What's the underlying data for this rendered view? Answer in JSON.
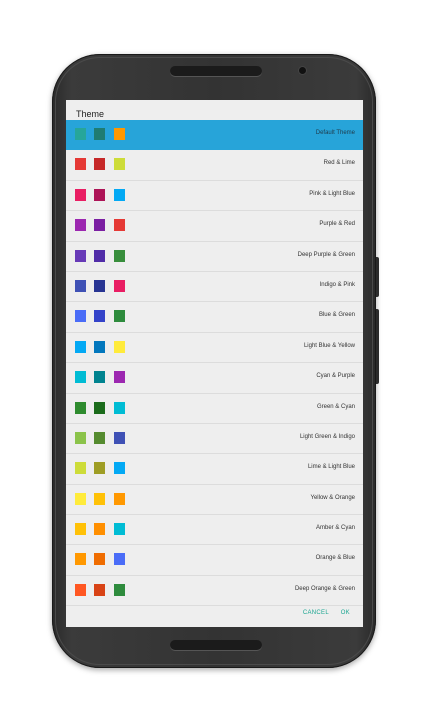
{
  "dialog": {
    "title": "Theme",
    "cancel_label": "CANCEL",
    "ok_label": "OK",
    "selected_color": "#27a4d9"
  },
  "themes": [
    {
      "label": "Default Theme",
      "selected": true,
      "swatches": [
        "#26a69a",
        "#1f7c72",
        "#ff9800"
      ]
    },
    {
      "label": "Red & Lime",
      "swatches": [
        "#e53935",
        "#c62828",
        "#cddc39"
      ]
    },
    {
      "label": "Pink & Light Blue",
      "swatches": [
        "#e91e63",
        "#ad1457",
        "#03a9f4"
      ]
    },
    {
      "label": "Purple & Red",
      "swatches": [
        "#9c27b0",
        "#7b1fa2",
        "#e53935"
      ]
    },
    {
      "label": "Deep Purple & Green",
      "swatches": [
        "#673ab7",
        "#512da8",
        "#388e3c"
      ]
    },
    {
      "label": "Indigo & Pink",
      "swatches": [
        "#3f51b5",
        "#283593",
        "#e91e63"
      ]
    },
    {
      "label": "Blue & Green",
      "swatches": [
        "#4a6cf7",
        "#3443c9",
        "#2e8b3d"
      ]
    },
    {
      "label": "Light Blue & Yellow",
      "swatches": [
        "#03a9f4",
        "#0277bd",
        "#ffeb3b"
      ]
    },
    {
      "label": "Cyan & Purple",
      "swatches": [
        "#00bcd4",
        "#00838f",
        "#9c27b0"
      ]
    },
    {
      "label": "Green & Cyan",
      "swatches": [
        "#2e8b2e",
        "#1b6b1b",
        "#00bcd4"
      ]
    },
    {
      "label": "Light Green & Indigo",
      "swatches": [
        "#8bc34a",
        "#558b2f",
        "#3f51b5"
      ]
    },
    {
      "label": "Lime & Light Blue",
      "swatches": [
        "#cddc39",
        "#9e9d24",
        "#03a9f4"
      ]
    },
    {
      "label": "Yellow & Orange",
      "swatches": [
        "#ffeb3b",
        "#ffc107",
        "#ff9800"
      ]
    },
    {
      "label": "Amber & Cyan",
      "swatches": [
        "#ffc107",
        "#ff8f00",
        "#00bcd4"
      ]
    },
    {
      "label": "Orange & Blue",
      "swatches": [
        "#ff9800",
        "#ef6c00",
        "#4a6cf7"
      ]
    },
    {
      "label": "Deep Orange & Green",
      "swatches": [
        "#ff5722",
        "#d84315",
        "#2e8b3d"
      ]
    }
  ]
}
